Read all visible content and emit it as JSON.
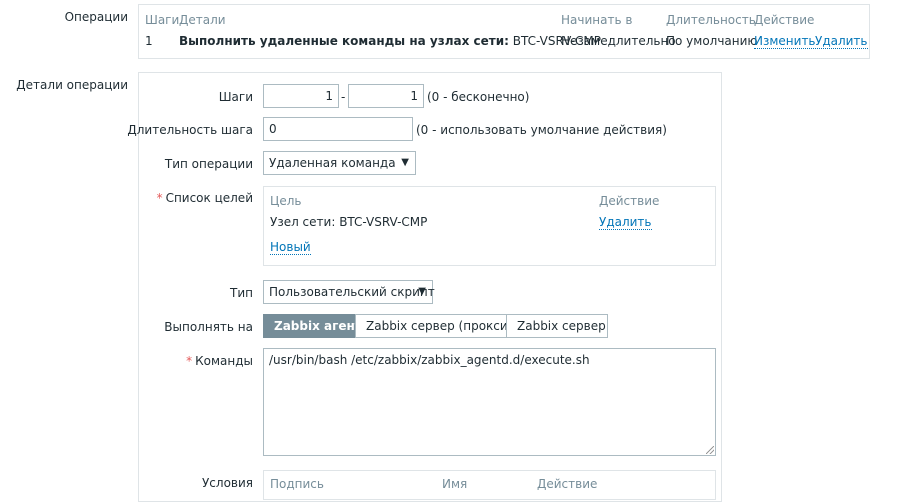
{
  "operations": {
    "label": "Операции",
    "headers": [
      "Шаги",
      "Детали",
      "Начинать в",
      "Длительность",
      "Действие"
    ],
    "row": {
      "step": "1",
      "details_bold": "Выполнить удаленные команды на узлах сети:",
      "details_host": "BTC-VSRV-CMP",
      "start": "Незамедлительно",
      "duration": "По умолчанию",
      "edit": "Изменить",
      "delete": "Удалить"
    }
  },
  "details": {
    "label": "Детали операции",
    "steps": {
      "label": "Шаги",
      "from": "1",
      "sep": "-",
      "to": "1",
      "hint": "(0 - бесконечно)"
    },
    "step_duration": {
      "label": "Длительность шага",
      "value": "0",
      "hint": "(0 - использовать умолчание действия)"
    },
    "operation_type": {
      "label": "Тип операции",
      "value": "Удаленная команда"
    },
    "targets": {
      "label": "Список целей",
      "col_target": "Цель",
      "col_action": "Действие",
      "row_target": "Узел сети: BTC-VSRV-CMP",
      "row_action": "Удалить",
      "new": "Новый"
    },
    "type": {
      "label": "Тип",
      "value": "Пользовательский скрипт"
    },
    "execute_on": {
      "label": "Выполнять на",
      "options": [
        "Zabbix агент",
        "Zabbix сервер (прокси)",
        "Zabbix сервер"
      ]
    },
    "commands": {
      "label": "Команды",
      "value": "/usr/bin/bash /etc/zabbix/zabbix_agentd.d/execute.sh"
    },
    "conditions": {
      "label": "Условия",
      "col_label": "Подпись",
      "col_name": "Имя",
      "col_action": "Действие"
    }
  },
  "colors": {
    "link": "#0275b8",
    "required": "#e45959",
    "active_segment": "#768d99"
  }
}
